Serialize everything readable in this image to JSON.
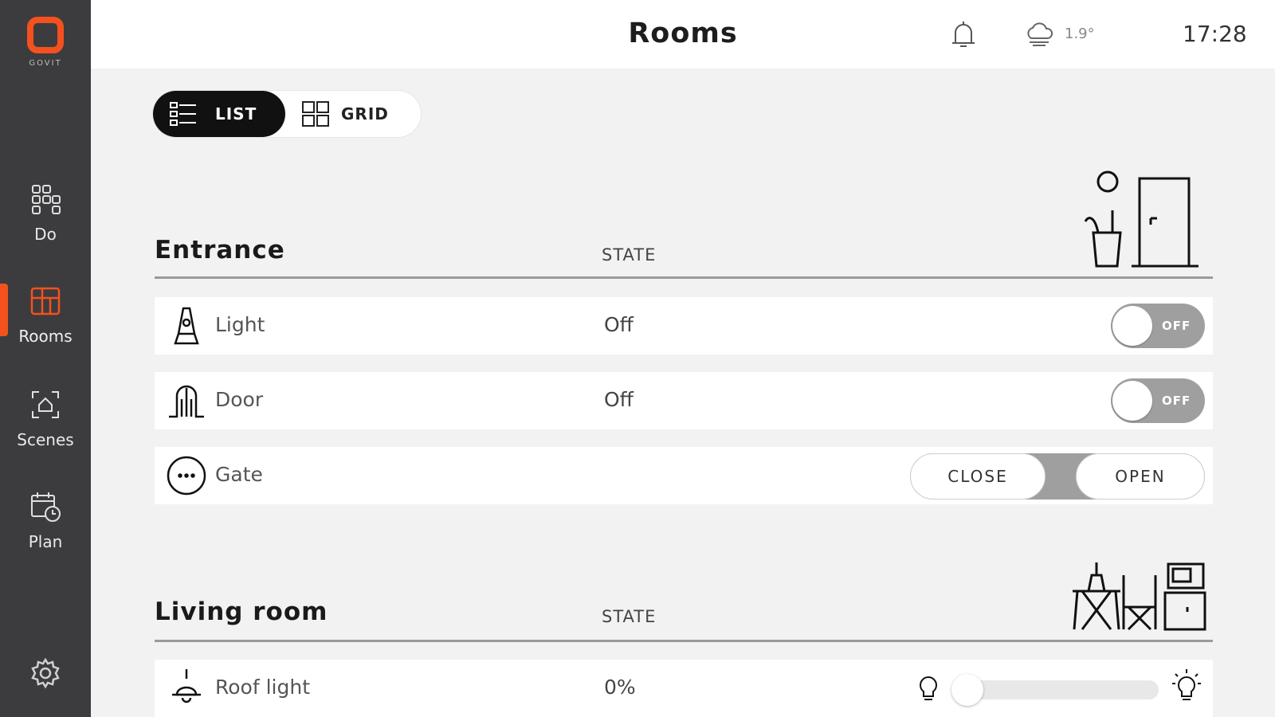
{
  "sidebar": {
    "logo_text": "GOVIT",
    "items": [
      {
        "label": "Do",
        "icon": "do-grid-icon"
      },
      {
        "label": "Rooms",
        "icon": "rooms-icon",
        "active": true
      },
      {
        "label": "Scenes",
        "icon": "scenes-icon"
      },
      {
        "label": "Plan",
        "icon": "plan-calendar-icon"
      }
    ],
    "settings_icon": "gear-icon"
  },
  "header": {
    "title": "Rooms",
    "temperature": "1.9°",
    "time": "17:28"
  },
  "view_toggle": {
    "list_label": "LIST",
    "grid_label": "GRID",
    "selected": "LIST"
  },
  "sections": [
    {
      "title": "Entrance",
      "state_header": "STATE",
      "rows": [
        {
          "label": "Light",
          "state": "Off",
          "control": "toggle",
          "toggle_text": "OFF"
        },
        {
          "label": "Door",
          "state": "Off",
          "control": "toggle",
          "toggle_text": "OFF"
        },
        {
          "label": "Gate",
          "state": "",
          "control": "close-open",
          "close_label": "CLOSE",
          "open_label": "OPEN"
        }
      ]
    },
    {
      "title": "Living room",
      "state_header": "STATE",
      "rows": [
        {
          "label": "Roof light",
          "state": "0%",
          "control": "dimmer",
          "level": 0
        }
      ]
    }
  ],
  "colors": {
    "accent": "#f4511e",
    "sidebar_bg": "#3c3c3e",
    "toggle_off": "#9f9f9f"
  }
}
